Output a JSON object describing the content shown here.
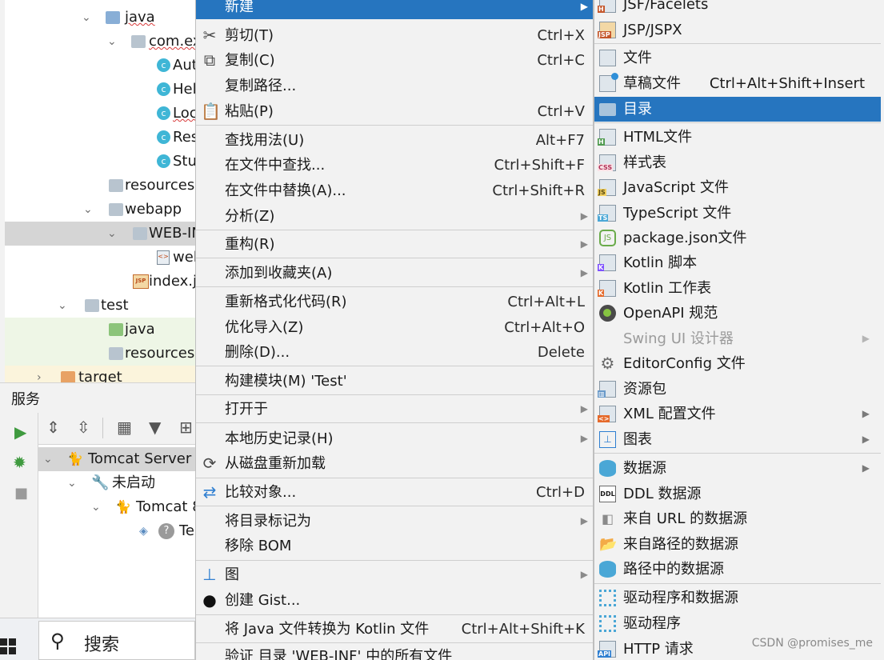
{
  "project_tree": {
    "rows": [
      {
        "label": "java"
      },
      {
        "label": "com.ex"
      },
      {
        "label": "Aut"
      },
      {
        "label": "Hel"
      },
      {
        "label": "Loc"
      },
      {
        "label": "Res"
      },
      {
        "label": "Stu"
      },
      {
        "label": "resources"
      },
      {
        "label": "webapp"
      },
      {
        "label": "WEB-IN"
      },
      {
        "label": "wel"
      },
      {
        "label": "index.j"
      },
      {
        "label": "test"
      },
      {
        "label": "java"
      },
      {
        "label": "resources"
      },
      {
        "label": "target"
      }
    ]
  },
  "services": {
    "title": "服务",
    "tree": [
      {
        "label": "Tomcat Server"
      },
      {
        "label": "未启动"
      },
      {
        "label": "Tomcat 8"
      },
      {
        "label": "Te"
      }
    ]
  },
  "taskbar": {
    "search_label": "搜索"
  },
  "context_menu": {
    "items": [
      {
        "label": "新建",
        "shortcut": "",
        "submenu": true
      },
      {
        "label": "剪切(T)",
        "shortcut": "Ctrl+X"
      },
      {
        "label": "复制(C)",
        "shortcut": "Ctrl+C"
      },
      {
        "label": "复制路径...",
        "shortcut": ""
      },
      {
        "label": "粘贴(P)",
        "shortcut": "Ctrl+V"
      },
      {
        "label": "查找用法(U)",
        "shortcut": "Alt+F7"
      },
      {
        "label": "在文件中查找...",
        "shortcut": "Ctrl+Shift+F"
      },
      {
        "label": "在文件中替换(A)...",
        "shortcut": "Ctrl+Shift+R"
      },
      {
        "label": "分析(Z)",
        "submenu": true
      },
      {
        "label": "重构(R)",
        "submenu": true
      },
      {
        "label": "添加到收藏夹(A)",
        "submenu": true
      },
      {
        "label": "重新格式化代码(R)",
        "shortcut": "Ctrl+Alt+L"
      },
      {
        "label": "优化导入(Z)",
        "shortcut": "Ctrl+Alt+O"
      },
      {
        "label": "删除(D)...",
        "shortcut": "Delete"
      },
      {
        "label": "构建模块(M) 'Test'",
        "shortcut": ""
      },
      {
        "label": "打开于",
        "submenu": true
      },
      {
        "label": "本地历史记录(H)",
        "submenu": true
      },
      {
        "label": "从磁盘重新加载",
        "shortcut": ""
      },
      {
        "label": "比较对象...",
        "shortcut": "Ctrl+D"
      },
      {
        "label": "将目录标记为",
        "submenu": true
      },
      {
        "label": "移除 BOM",
        "shortcut": ""
      },
      {
        "label": "图",
        "submenu": true
      },
      {
        "label": "创建 Gist...",
        "shortcut": ""
      },
      {
        "label": "将 Java 文件转换为 Kotlin 文件",
        "shortcut": "Ctrl+Alt+Shift+K"
      },
      {
        "label": "验证 目录 'WEB-INF' 中的所有文件",
        "shortcut": ""
      }
    ]
  },
  "new_submenu": {
    "items": [
      {
        "label": "JSF/Facelets"
      },
      {
        "label": "JSP/JSPX"
      },
      {
        "label": "文件"
      },
      {
        "label": "草稿文件",
        "shortcut": "Ctrl+Alt+Shift+Insert"
      },
      {
        "label": "目录"
      },
      {
        "label": "HTML文件"
      },
      {
        "label": "样式表"
      },
      {
        "label": "JavaScript 文件"
      },
      {
        "label": "TypeScript 文件"
      },
      {
        "label": "package.json文件"
      },
      {
        "label": "Kotlin 脚本"
      },
      {
        "label": "Kotlin 工作表"
      },
      {
        "label": "OpenAPI 规范"
      },
      {
        "label": "Swing UI 设计器"
      },
      {
        "label": "EditorConfig 文件"
      },
      {
        "label": "资源包"
      },
      {
        "label": "XML 配置文件"
      },
      {
        "label": "图表"
      },
      {
        "label": "数据源"
      },
      {
        "label": "DDL 数据源"
      },
      {
        "label": "来自 URL 的数据源"
      },
      {
        "label": "来自路径的数据源"
      },
      {
        "label": "路径中的数据源"
      },
      {
        "label": "驱动程序和数据源"
      },
      {
        "label": "驱动程序"
      },
      {
        "label": "HTTP 请求"
      }
    ]
  },
  "watermark": "CSDN @promises_me",
  "colors": {
    "selection": "#2675bf",
    "menu_bg": "#f2f2f2",
    "separator": "#cfcfcf"
  }
}
